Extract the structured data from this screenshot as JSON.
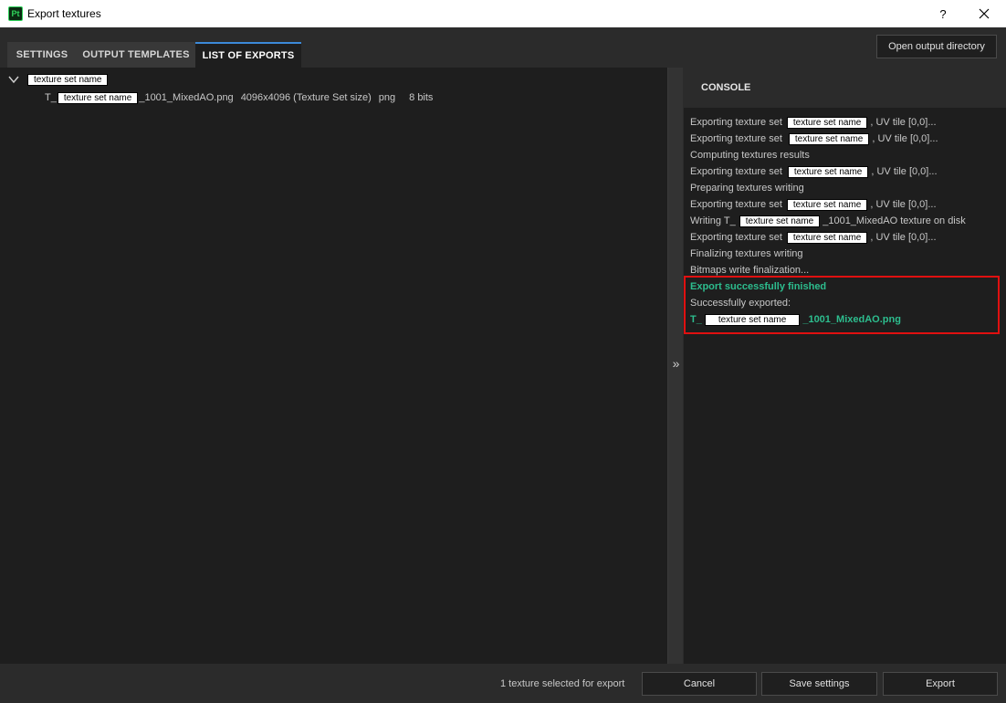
{
  "window": {
    "icon_text": "Pt",
    "title": "Export textures",
    "help": "?",
    "close": "✕"
  },
  "tabs": [
    {
      "label": "SETTINGS"
    },
    {
      "label": "OUTPUT TEMPLATES"
    },
    {
      "label": "LIST OF EXPORTS",
      "active": true
    }
  ],
  "toolbar": {
    "open_dir_label": "Open output directory"
  },
  "export_list": {
    "root_name": "texture set name",
    "child": {
      "prefix": "T_",
      "set_name": "texture set name",
      "suffix": "_1001_MixedAO.png",
      "resolution": "4096x4096 (Texture Set size)",
      "format": "png",
      "bits": "8 bits"
    }
  },
  "splitter": {
    "icon": "»"
  },
  "console": {
    "title": "CONSOLE",
    "lines": [
      {
        "pre": "Exporting texture set",
        "name": "texture set name",
        "post": ", UV tile [0,0]..."
      },
      {
        "pre": "Exporting texture set",
        "name": "texture set name",
        "post": ", UV tile [0,0]..."
      },
      {
        "pre": "Computing textures results"
      },
      {
        "pre": "Exporting texture set",
        "name": "texture set name",
        "post": ", UV tile [0,0]..."
      },
      {
        "pre": "Preparing textures writing"
      },
      {
        "pre": "Exporting texture set",
        "name": "texture set name",
        "post": ", UV tile [0,0]..."
      },
      {
        "pre": "Writing T_",
        "name": "texture set name",
        "post": "_1001_MixedAO texture on disk"
      },
      {
        "pre": "Exporting texture set",
        "name": "texture set name",
        "post": ", UV tile [0,0]..."
      },
      {
        "pre": "Finalizing textures writing"
      },
      {
        "pre": "Bitmaps write finalization..."
      },
      {
        "pre": "Export successfully finished",
        "green": true
      },
      {
        "pre": "Successfully exported:"
      },
      {
        "pre": "T_",
        "name": "texture set name",
        "post": "_1001_MixedAO.png",
        "green": true
      }
    ]
  },
  "footer": {
    "status": "1 texture selected for export",
    "cancel_label": "Cancel",
    "save_label": "Save settings",
    "export_label": "Export"
  },
  "colors": {
    "accent_tab": "#3c8ad8",
    "success_green": "#2dbd8e",
    "highlight_red": "#e01010"
  }
}
